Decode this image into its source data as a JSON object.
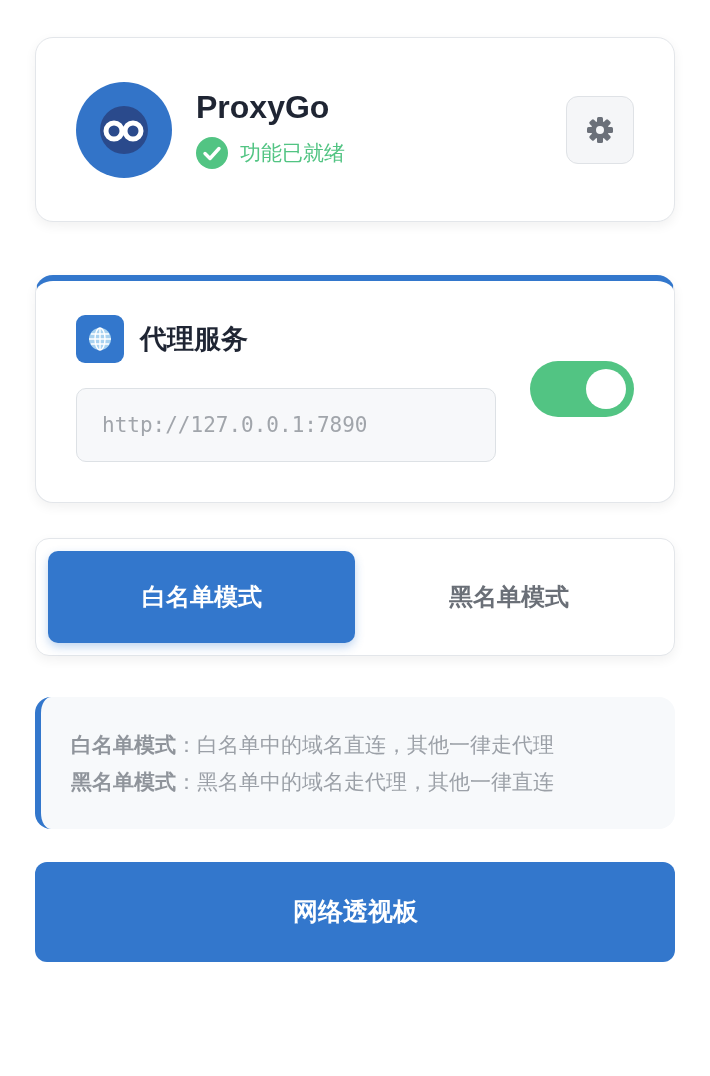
{
  "app": {
    "title": "ProxyGo",
    "status": "功能已就绪",
    "ready": true
  },
  "proxy": {
    "title": "代理服务",
    "placeholder": "http://127.0.0.1:7890",
    "on": true
  },
  "modes": [
    {
      "label": "白名单模式",
      "selected": true
    },
    {
      "label": "黑名单模式",
      "selected": false
    }
  ],
  "info": [
    "**白名单模式**：白名单中的域名直连，其他一律走代理",
    "**黑名单模式**：黑名单中的域名走代理，其他一律直连"
  ],
  "action": {
    "label": "网络透视板"
  }
}
